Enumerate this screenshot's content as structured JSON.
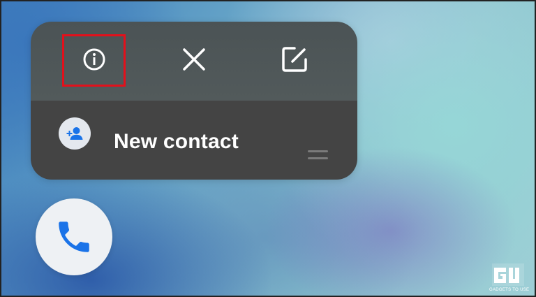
{
  "popup": {
    "actions": [
      {
        "id": "app-info",
        "icon": "info-icon"
      },
      {
        "id": "remove",
        "icon": "close-icon"
      },
      {
        "id": "edit",
        "icon": "edit-icon"
      }
    ],
    "shortcut": {
      "label": "New contact",
      "icon": "add-contact-icon"
    }
  },
  "app": {
    "icon": "phone-icon"
  },
  "watermark": {
    "logo": "G",
    "text": "GADGETS TO USE"
  },
  "colors": {
    "accent": "#1a73e8",
    "highlight": "#e3101b",
    "panel_top": "#4b5355",
    "panel_bottom": "#444444"
  }
}
